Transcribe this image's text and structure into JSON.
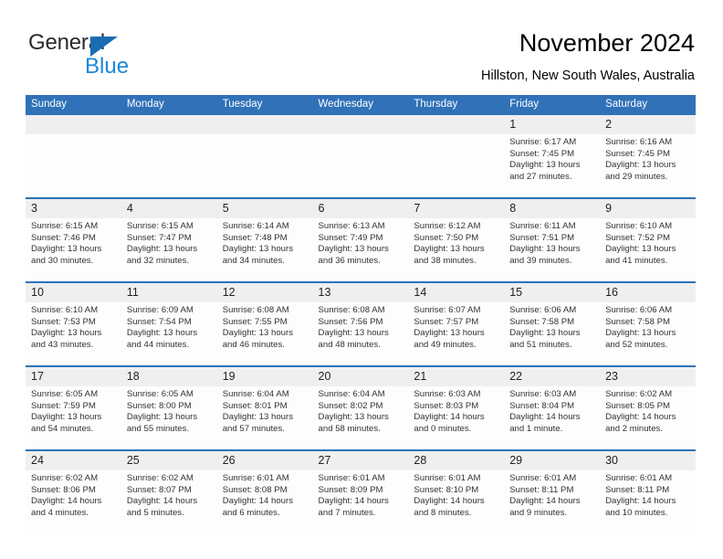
{
  "brand": {
    "name_part1": "General",
    "name_part2": "Blue",
    "logo_icon": "triangle-flag-icon"
  },
  "header": {
    "title": "November 2024",
    "subtitle": "Hillston, New South Wales, Australia"
  },
  "colors": {
    "header_blue": "#3071b8",
    "brand_blue": "#1b87d8",
    "logo_blue": "#1b6cb3",
    "daynum_bg": "#efefef",
    "cell_bg": "#fdfdfd"
  },
  "weekday_headers": [
    "Sunday",
    "Monday",
    "Tuesday",
    "Wednesday",
    "Thursday",
    "Friday",
    "Saturday"
  ],
  "labels": {
    "sunrise": "Sunrise:",
    "sunset": "Sunset:",
    "daylight": "Daylight:"
  },
  "weeks": [
    {
      "days": [
        {
          "num": "",
          "lines": [
            "",
            "",
            ""
          ]
        },
        {
          "num": "",
          "lines": [
            "",
            "",
            ""
          ]
        },
        {
          "num": "",
          "lines": [
            "",
            "",
            ""
          ]
        },
        {
          "num": "",
          "lines": [
            "",
            "",
            ""
          ]
        },
        {
          "num": "",
          "lines": [
            "",
            "",
            ""
          ]
        },
        {
          "num": "1",
          "lines": [
            "Sunrise: 6:17 AM",
            "Sunset: 7:45 PM",
            "Daylight: 13 hours and 27 minutes."
          ]
        },
        {
          "num": "2",
          "lines": [
            "Sunrise: 6:16 AM",
            "Sunset: 7:45 PM",
            "Daylight: 13 hours and 29 minutes."
          ]
        }
      ]
    },
    {
      "days": [
        {
          "num": "3",
          "lines": [
            "Sunrise: 6:15 AM",
            "Sunset: 7:46 PM",
            "Daylight: 13 hours and 30 minutes."
          ]
        },
        {
          "num": "4",
          "lines": [
            "Sunrise: 6:15 AM",
            "Sunset: 7:47 PM",
            "Daylight: 13 hours and 32 minutes."
          ]
        },
        {
          "num": "5",
          "lines": [
            "Sunrise: 6:14 AM",
            "Sunset: 7:48 PM",
            "Daylight: 13 hours and 34 minutes."
          ]
        },
        {
          "num": "6",
          "lines": [
            "Sunrise: 6:13 AM",
            "Sunset: 7:49 PM",
            "Daylight: 13 hours and 36 minutes."
          ]
        },
        {
          "num": "7",
          "lines": [
            "Sunrise: 6:12 AM",
            "Sunset: 7:50 PM",
            "Daylight: 13 hours and 38 minutes."
          ]
        },
        {
          "num": "8",
          "lines": [
            "Sunrise: 6:11 AM",
            "Sunset: 7:51 PM",
            "Daylight: 13 hours and 39 minutes."
          ]
        },
        {
          "num": "9",
          "lines": [
            "Sunrise: 6:10 AM",
            "Sunset: 7:52 PM",
            "Daylight: 13 hours and 41 minutes."
          ]
        }
      ]
    },
    {
      "days": [
        {
          "num": "10",
          "lines": [
            "Sunrise: 6:10 AM",
            "Sunset: 7:53 PM",
            "Daylight: 13 hours and 43 minutes."
          ]
        },
        {
          "num": "11",
          "lines": [
            "Sunrise: 6:09 AM",
            "Sunset: 7:54 PM",
            "Daylight: 13 hours and 44 minutes."
          ]
        },
        {
          "num": "12",
          "lines": [
            "Sunrise: 6:08 AM",
            "Sunset: 7:55 PM",
            "Daylight: 13 hours and 46 minutes."
          ]
        },
        {
          "num": "13",
          "lines": [
            "Sunrise: 6:08 AM",
            "Sunset: 7:56 PM",
            "Daylight: 13 hours and 48 minutes."
          ]
        },
        {
          "num": "14",
          "lines": [
            "Sunrise: 6:07 AM",
            "Sunset: 7:57 PM",
            "Daylight: 13 hours and 49 minutes."
          ]
        },
        {
          "num": "15",
          "lines": [
            "Sunrise: 6:06 AM",
            "Sunset: 7:58 PM",
            "Daylight: 13 hours and 51 minutes."
          ]
        },
        {
          "num": "16",
          "lines": [
            "Sunrise: 6:06 AM",
            "Sunset: 7:58 PM",
            "Daylight: 13 hours and 52 minutes."
          ]
        }
      ]
    },
    {
      "days": [
        {
          "num": "17",
          "lines": [
            "Sunrise: 6:05 AM",
            "Sunset: 7:59 PM",
            "Daylight: 13 hours and 54 minutes."
          ]
        },
        {
          "num": "18",
          "lines": [
            "Sunrise: 6:05 AM",
            "Sunset: 8:00 PM",
            "Daylight: 13 hours and 55 minutes."
          ]
        },
        {
          "num": "19",
          "lines": [
            "Sunrise: 6:04 AM",
            "Sunset: 8:01 PM",
            "Daylight: 13 hours and 57 minutes."
          ]
        },
        {
          "num": "20",
          "lines": [
            "Sunrise: 6:04 AM",
            "Sunset: 8:02 PM",
            "Daylight: 13 hours and 58 minutes."
          ]
        },
        {
          "num": "21",
          "lines": [
            "Sunrise: 6:03 AM",
            "Sunset: 8:03 PM",
            "Daylight: 14 hours and 0 minutes."
          ]
        },
        {
          "num": "22",
          "lines": [
            "Sunrise: 6:03 AM",
            "Sunset: 8:04 PM",
            "Daylight: 14 hours and 1 minute."
          ]
        },
        {
          "num": "23",
          "lines": [
            "Sunrise: 6:02 AM",
            "Sunset: 8:05 PM",
            "Daylight: 14 hours and 2 minutes."
          ]
        }
      ]
    },
    {
      "days": [
        {
          "num": "24",
          "lines": [
            "Sunrise: 6:02 AM",
            "Sunset: 8:06 PM",
            "Daylight: 14 hours and 4 minutes."
          ]
        },
        {
          "num": "25",
          "lines": [
            "Sunrise: 6:02 AM",
            "Sunset: 8:07 PM",
            "Daylight: 14 hours and 5 minutes."
          ]
        },
        {
          "num": "26",
          "lines": [
            "Sunrise: 6:01 AM",
            "Sunset: 8:08 PM",
            "Daylight: 14 hours and 6 minutes."
          ]
        },
        {
          "num": "27",
          "lines": [
            "Sunrise: 6:01 AM",
            "Sunset: 8:09 PM",
            "Daylight: 14 hours and 7 minutes."
          ]
        },
        {
          "num": "28",
          "lines": [
            "Sunrise: 6:01 AM",
            "Sunset: 8:10 PM",
            "Daylight: 14 hours and 8 minutes."
          ]
        },
        {
          "num": "29",
          "lines": [
            "Sunrise: 6:01 AM",
            "Sunset: 8:11 PM",
            "Daylight: 14 hours and 9 minutes."
          ]
        },
        {
          "num": "30",
          "lines": [
            "Sunrise: 6:01 AM",
            "Sunset: 8:11 PM",
            "Daylight: 14 hours and 10 minutes."
          ]
        }
      ]
    }
  ]
}
